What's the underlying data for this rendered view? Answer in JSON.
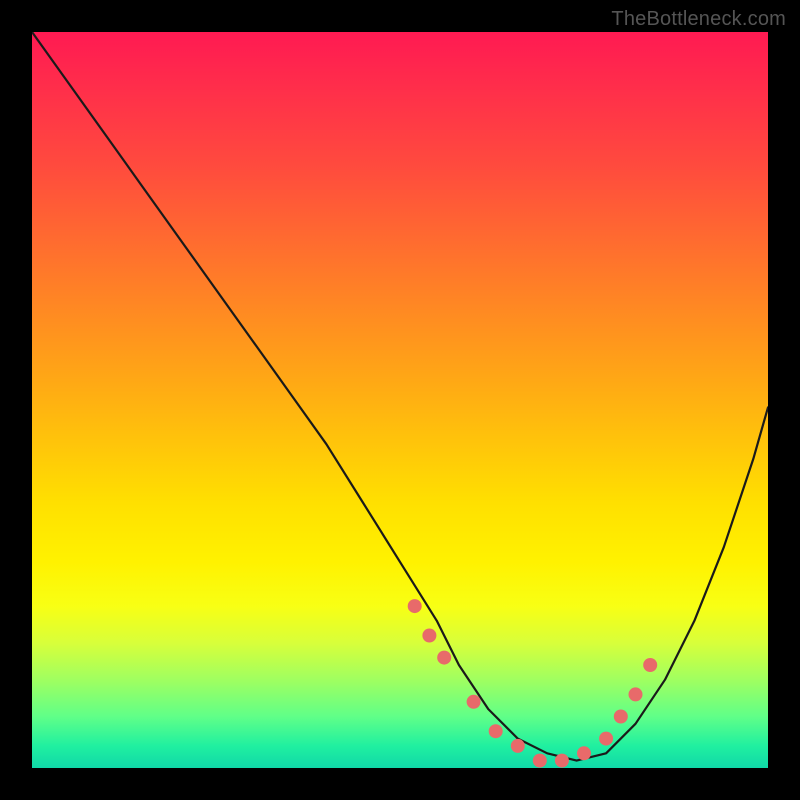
{
  "watermark": "TheBottleneck.com",
  "chart_data": {
    "type": "line",
    "title": "",
    "xlabel": "",
    "ylabel": "",
    "xlim": [
      0,
      100
    ],
    "ylim": [
      0,
      100
    ],
    "grid": false,
    "series": [
      {
        "name": "curve",
        "x": [
          0,
          5,
          10,
          15,
          20,
          25,
          30,
          35,
          40,
          45,
          50,
          55,
          58,
          62,
          66,
          70,
          74,
          78,
          82,
          86,
          90,
          94,
          98,
          100
        ],
        "y": [
          100,
          93,
          86,
          79,
          72,
          65,
          58,
          51,
          44,
          36,
          28,
          20,
          14,
          8,
          4,
          2,
          1,
          2,
          6,
          12,
          20,
          30,
          42,
          49
        ]
      }
    ],
    "scatter": {
      "name": "dots",
      "x": [
        52,
        54,
        56,
        60,
        63,
        66,
        69,
        72,
        75,
        78,
        80,
        82,
        84
      ],
      "y": [
        22,
        18,
        15,
        9,
        5,
        3,
        1,
        1,
        2,
        4,
        7,
        10,
        14
      ]
    },
    "background": {
      "type": "vertical-gradient",
      "stops": [
        {
          "pos": 0.0,
          "color": "#ff1a52"
        },
        {
          "pos": 0.5,
          "color": "#ffaa14"
        },
        {
          "pos": 0.75,
          "color": "#fff200"
        },
        {
          "pos": 1.0,
          "color": "#10d8a8"
        }
      ]
    }
  }
}
